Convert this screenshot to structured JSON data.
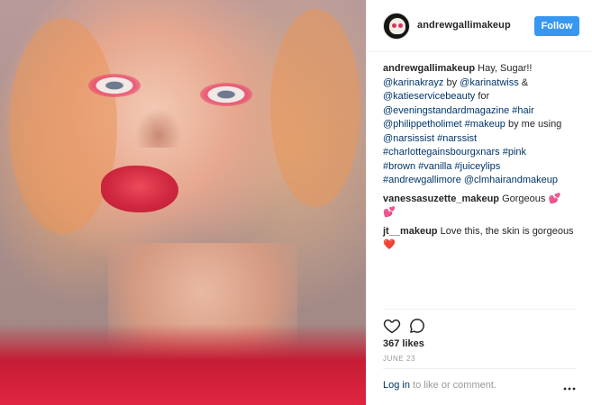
{
  "post": {
    "author": "andrewgallimakeup",
    "follow_label": "Follow",
    "caption": {
      "author": "andrewgallimakeup",
      "text_intro": " Hay, Sugar!!",
      "mention_1": "@karinakrayz",
      "by": " by ",
      "mention_2": "@karinatwiss",
      "amp": " &",
      "mention_3": "@katieservicebeauty",
      "for": " for",
      "mention_4": "@eveningstandardmagazine",
      "tag_hair": "#hair",
      "mention_5": "@philippetholimet",
      "tag_makeup": "#makeup",
      "by_me_using": " by me using",
      "mention_6": "@narsissist",
      "tag_narssist": "#narssist",
      "tag_charlotte": "#charlottegainsbourgxnars",
      "tag_pink": "#pink",
      "tag_brown": "#brown",
      "tag_vanilla": "#vanilla",
      "tag_juicey": "#juiceylips",
      "tag_andrew": "#andrewgallimore",
      "mention_7": "@clmhairandmakeup"
    },
    "comments": [
      {
        "user": "vanessasuzette_makeup",
        "text": " Gorgeous ",
        "emoji": "💕",
        "emoji2": "💕"
      },
      {
        "user": "jt__makeup",
        "text": " Love this, the skin is gorgeous ",
        "emoji": "❤️"
      }
    ],
    "likes": "367 likes",
    "date": "JUNE 23",
    "footer": {
      "login": "Log in",
      "rest": " to like or comment.",
      "more": "•••"
    }
  },
  "icons": {
    "heart": "heart-icon",
    "comment": "comment-icon",
    "more": "more-options-icon",
    "avatar": "avatar-icon"
  },
  "colors": {
    "follow_bg": "#3897f0",
    "link": "#003569",
    "muted": "#999999",
    "border": "#efefef"
  }
}
